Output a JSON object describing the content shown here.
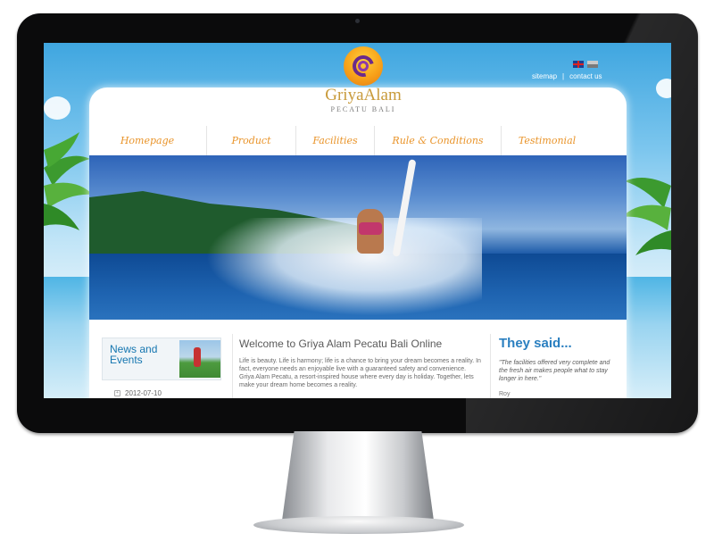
{
  "site": {
    "brand_name": "GriyaAlam",
    "brand_subtitle": "PECATU BALI"
  },
  "header": {
    "languages": [
      "english-flag-icon",
      "indonesia-flag-icon"
    ],
    "links": [
      "sitemap",
      "|",
      "contact us"
    ]
  },
  "nav": {
    "items": [
      {
        "label": "Homepage"
      },
      {
        "label": "Product"
      },
      {
        "label": "Facilities"
      },
      {
        "label": "Rule & Conditions"
      },
      {
        "label": "Testimonial"
      }
    ]
  },
  "news": {
    "title": "News and Events",
    "date": "2012-07-10"
  },
  "welcome": {
    "title": "Welcome to Griya Alam Pecatu Bali Online",
    "body": "Life is beauty. Life is harmony; life is a chance to bring your dream becomes a reality. In fact, everyone needs an enjoyable live with a guaranteed safety and convenience. Griya Alam Pecatu, a resort-inspired house where every day is holiday. Together, lets make your dream home becomes a reality."
  },
  "testimonial": {
    "title": "They said...",
    "quote": "\"The facilities offered very complete and the fresh air makes people what to stay longer in here.\"",
    "author": "Roy"
  },
  "colors": {
    "nav_text": "#e9942a",
    "accent_blue": "#2a7fc0",
    "monitor_bezel": "#0b0b0c"
  }
}
